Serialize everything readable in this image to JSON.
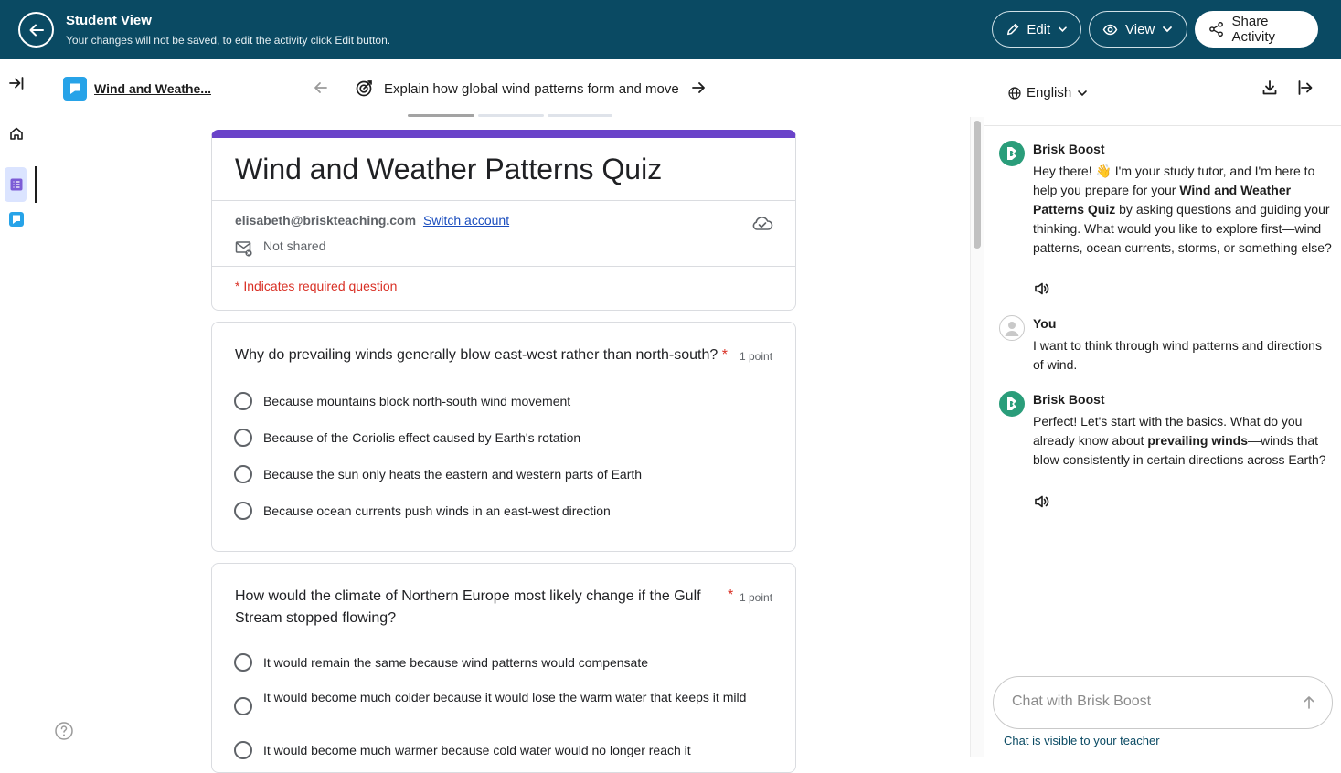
{
  "topbar": {
    "title": "Student View",
    "subtitle": "Your changes will not be saved, to edit the activity click Edit button.",
    "edit_label": "Edit",
    "view_label": "View",
    "share_label": "Share Activity"
  },
  "activity": {
    "title": "Wind and Weathe...",
    "goal": "Explain how global wind patterns form and move",
    "progress_steps": 3,
    "current_step": 1
  },
  "form": {
    "title": "Wind and Weather Patterns Quiz",
    "email": "elisabeth@briskteaching.com",
    "switch_account": "Switch account",
    "share_status": "Not shared",
    "required_note": "* Indicates required question",
    "questions": [
      {
        "text": "Why do prevailing winds generally blow east-west rather than north-south?",
        "required_mark": "*",
        "points": "1 point",
        "options": [
          "Because mountains block north-south wind movement",
          "Because of the Coriolis effect caused by Earth's rotation",
          "Because the sun only heats the eastern and western parts of Earth",
          "Because ocean currents push winds in an east-west direction"
        ]
      },
      {
        "text": "How would the climate of Northern Europe most likely change if the Gulf Stream stopped flowing?",
        "required_mark": "*",
        "points": "1 point",
        "options": [
          "It would remain the same because wind patterns would compensate",
          "It would become much colder because it would lose the warm water that keeps it mild",
          "It would become much warmer because cold water would no longer reach it"
        ]
      }
    ]
  },
  "chat": {
    "language": "English",
    "messages": [
      {
        "sender": "Brisk Boost",
        "parts": [
          {
            "t": "Hey there! 👋 I'm your study tutor, and I'm here to help you prepare for your "
          },
          {
            "t": "Wind and Weather Patterns Quiz",
            "b": true
          },
          {
            "t": " by asking questions and guiding your thinking. What would you like to explore first—wind patterns, ocean currents, storms, or something else?"
          }
        ]
      },
      {
        "sender": "You",
        "text": "I want to think through wind patterns and directions of wind."
      },
      {
        "sender": "Brisk Boost",
        "parts": [
          {
            "t": "Perfect! Let's start with the basics. What do you already know about "
          },
          {
            "t": "prevailing winds",
            "b": true
          },
          {
            "t": "—winds that blow consistently in certain directions across Earth?"
          }
        ]
      }
    ],
    "input_placeholder": "Chat with Brisk Boost",
    "visibility_note": "Chat is visible to your teacher"
  },
  "icons": {
    "back": "arrow-left-icon",
    "edit": "pencil-icon",
    "view": "eye-icon",
    "share": "share-icon",
    "rail_expand": "expand-right-icon",
    "rail_home": "home-icon",
    "rail_list": "list-icon",
    "rail_activity": "activity-icon",
    "help": "help-icon",
    "goal": "target-icon",
    "cloud": "cloud-saved-icon",
    "not_shared": "mail-off-icon",
    "globe": "globe-icon",
    "download": "download-icon",
    "exit": "exit-panel-icon",
    "speaker": "speaker-icon",
    "send": "arrow-up-icon"
  },
  "colors": {
    "topbar_bg": "#0a4a63",
    "form_accent": "#6a43c9",
    "required_red": "#d93025",
    "link_blue": "#1a4dbe",
    "bot_avatar": "#2a9d7a",
    "activity_icon": "#27a3e8"
  }
}
